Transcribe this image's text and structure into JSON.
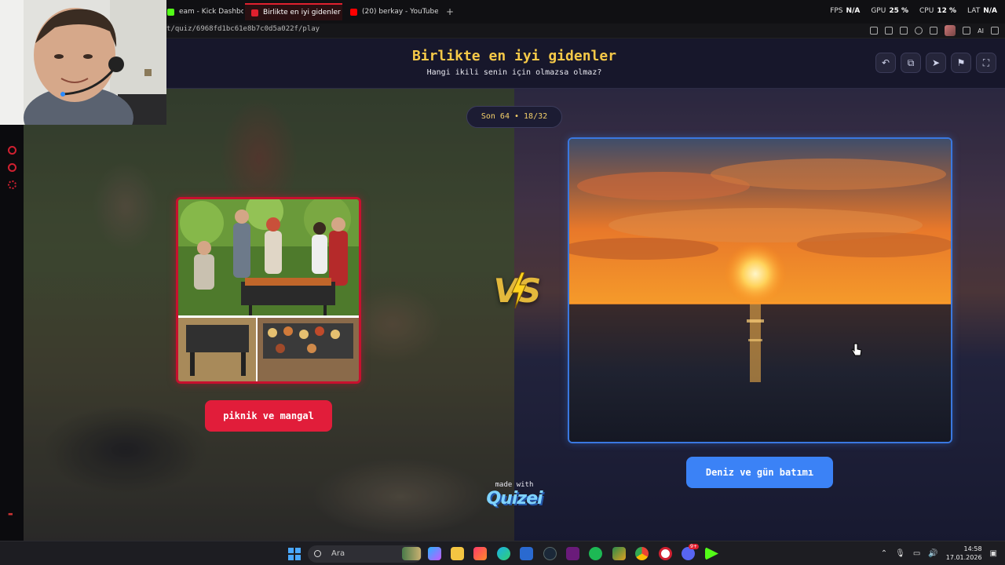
{
  "browser": {
    "tabs": [
      {
        "label": "eam - Kick Dashboard",
        "color": "#53fc18"
      },
      {
        "label": "Birlikte en iyi gidenler - Ti",
        "color": "#e0202e"
      },
      {
        "label": "(20) berkay - YouTube",
        "color": "#ff0000"
      }
    ],
    "new_tab": "+",
    "url": "t/quiz/6968fd1bc61e8b7c0d5a022f/play",
    "stats": [
      {
        "label": "FPS",
        "value": "N/A"
      },
      {
        "label": "GPU",
        "value": "25 %"
      },
      {
        "label": "CPU",
        "value": "12 %"
      },
      {
        "label": "LAT",
        "value": "N/A"
      }
    ],
    "ai_label": "AI"
  },
  "quiz": {
    "title": "Birlikte en iyi gidenler",
    "subtitle": "Hangi ikili senin için olmazsa olmaz?",
    "round": "Son 64 • 18/32",
    "vs": "VS",
    "left_choice": "piknik ve mangal",
    "right_choice": "Deniz ve gün batımı",
    "made_with": "made with",
    "brand": "Quizei",
    "header_buttons": [
      "undo-icon",
      "share-icon",
      "send-icon",
      "flag-icon",
      "fullscreen-icon"
    ]
  },
  "taskbar": {
    "search_placeholder": "Ara",
    "time": "14:58",
    "date": "17.01.2026",
    "apps": [
      "widgets",
      "copilot",
      "file-explorer",
      "opera-gx",
      "edge",
      "store",
      "steam",
      "visual-studio",
      "spotify",
      "app",
      "chrome",
      "opera",
      "discord",
      "kick"
    ],
    "discord_badge": "9+"
  },
  "colors": {
    "title_gold": "#f6c948",
    "left_accent": "#e11d3a",
    "right_accent": "#3b82f6",
    "header_bg": "#17172b"
  }
}
